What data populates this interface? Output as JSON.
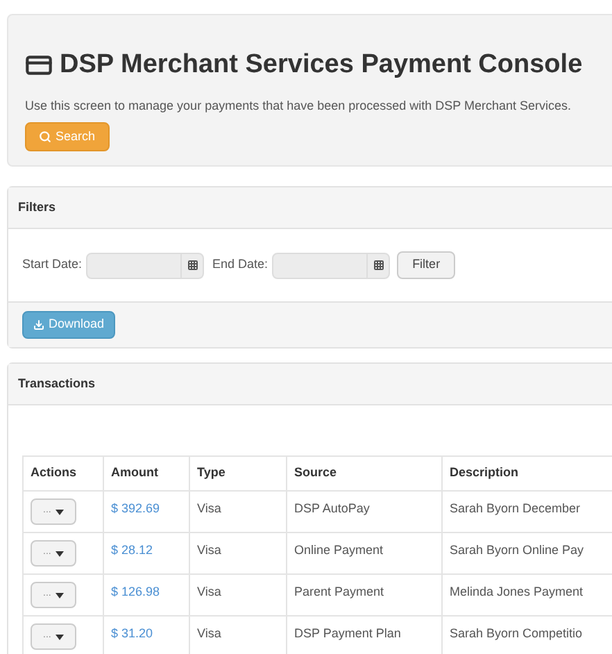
{
  "header": {
    "title": "DSP Merchant Services Payment Console",
    "subtitle": "Use this screen to manage your payments that have been processed with DSP Merchant Services.",
    "search_button": "Search"
  },
  "filters": {
    "title": "Filters",
    "start_label": "Start Date:",
    "end_label": "End Date:",
    "filter_button": "Filter",
    "download_button": "Download"
  },
  "transactions": {
    "title": "Transactions",
    "columns": [
      "Actions",
      "Amount",
      "Type",
      "Source",
      "Description"
    ],
    "rows": [
      {
        "action": "...",
        "amount": "$ 392.69",
        "type": "Visa",
        "source": "DSP AutoPay",
        "description": "Sarah Byorn December"
      },
      {
        "action": "...",
        "amount": "$ 28.12",
        "type": "Visa",
        "source": "Online Payment",
        "description": "Sarah Byorn Online Pay"
      },
      {
        "action": "...",
        "amount": "$ 126.98",
        "type": "Visa",
        "source": "Parent Payment",
        "description": "Melinda Jones Payment"
      },
      {
        "action": "...",
        "amount": "$ 31.20",
        "type": "Visa",
        "source": "DSP Payment Plan",
        "description": "Sarah Byorn Competitio"
      }
    ]
  }
}
